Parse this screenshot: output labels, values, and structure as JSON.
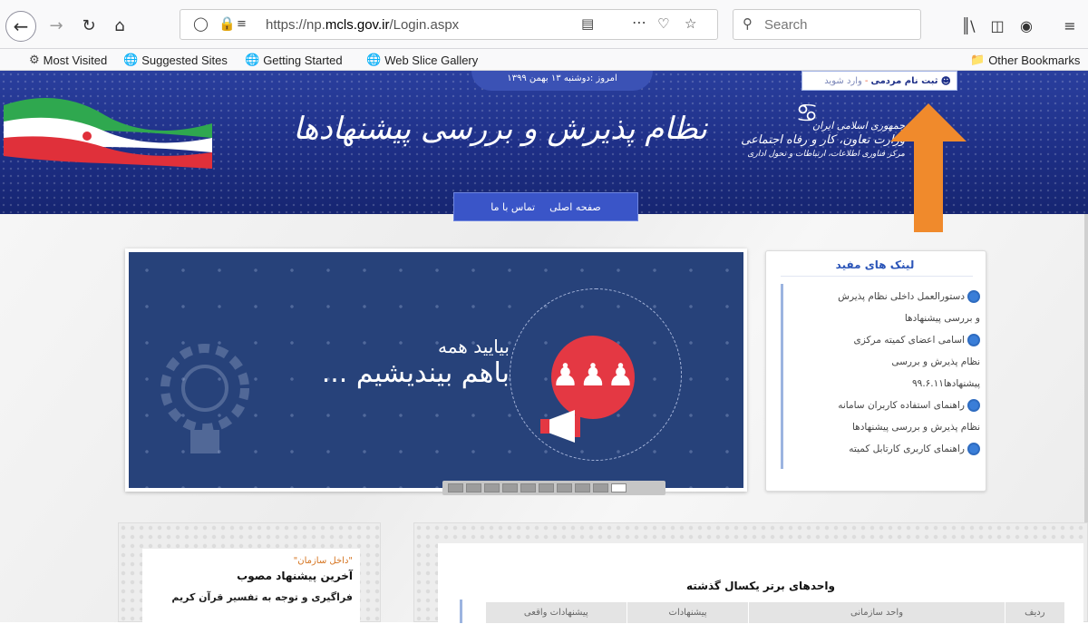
{
  "browser": {
    "url_prefix": "https://np.",
    "url_domain": "mcls.gov.ir",
    "url_path": "/Login.aspx",
    "search_placeholder": "Search",
    "bookmarks": [
      "Most Visited",
      "Suggested Sites",
      "Getting Started",
      "Web Slice Gallery"
    ],
    "other_bookmarks": "Other Bookmarks"
  },
  "header": {
    "date": "امروز :دوشنبه ۱۳ بهمن ۱۳۹۹",
    "register": "ثبت نام مردمی",
    "separator": "-",
    "login": "وارد شوید",
    "site_title": "نظام پذیرش و بررسی پیشنهادها",
    "ministry_line1": "جمهوری اسلامی ایران",
    "ministry_line2": "وزارت تعاون، کار و رفاه اجتماعی",
    "ministry_line3": "مرکز فناوری اطلاعات، ارتباطات و تحول اداری",
    "nav": [
      "صفحه اصلی",
      "تماس با ما"
    ]
  },
  "slider": {
    "line1": "بیایید همه",
    "line2": "باهم بیندیشیم ...",
    "page_count": 10
  },
  "useful_links": {
    "title": "لینک های مفید",
    "items": [
      {
        "text": "دستورالعمل داخلی نظام پذیرش",
        "globe": true
      },
      {
        "text": "و بررسی پیشنهادها",
        "globe": false
      },
      {
        "text": "اسامی اعضای کمیته مرکزی",
        "globe": true
      },
      {
        "text": "نظام پذیرش و بررسی",
        "globe": false
      },
      {
        "text": "پیشنهادها۹۹.۶.۱۱",
        "globe": false
      },
      {
        "text": "راهنمای استفاده کاربران سامانه",
        "globe": true
      },
      {
        "text": "نظام پذیرش و بررسی پیشنهادها",
        "globe": false
      },
      {
        "text": "راهنمای کاربری کارتابل کمیته",
        "globe": true
      }
    ]
  },
  "latest": {
    "tag": "\"داخل سازمان\"",
    "title": "آخرین پیشنهاد مصوب",
    "item": "فراگیری و توجه به تفسیر قرآن کریم"
  },
  "units": {
    "title": "واحدهای برتر یکسال گذشته",
    "columns": [
      "ردیف",
      "واحد سازمانی",
      "پیشنهادات",
      "پیشنهادات واقعی"
    ]
  }
}
